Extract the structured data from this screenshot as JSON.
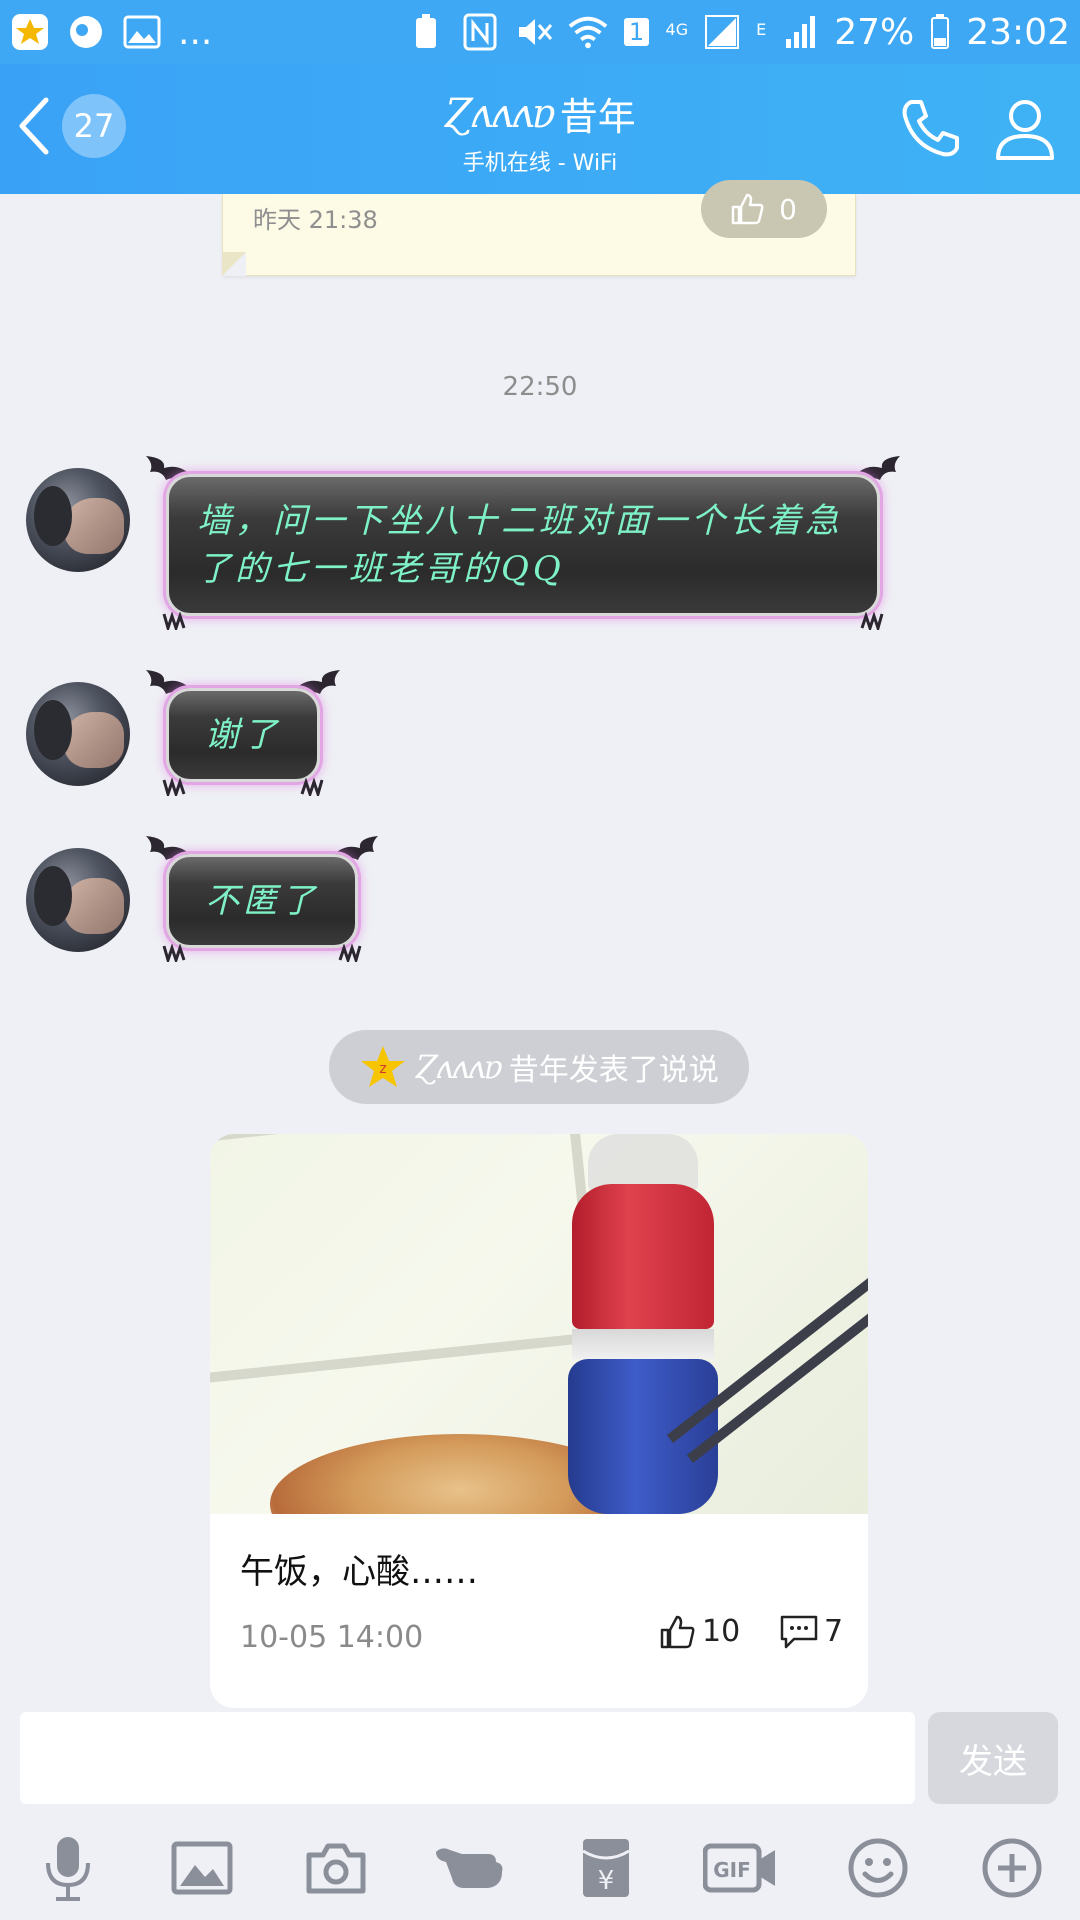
{
  "status_bar": {
    "overflow_dots": "...",
    "sim_badge": "1",
    "network_4g": "4G",
    "network_e": "E",
    "battery": "27%",
    "time": "23:02"
  },
  "header": {
    "unread_count": "27",
    "contact_sig": "Ɀʌʌʌɐ",
    "contact_name": "昔年",
    "status": "手机在线 - WiFi"
  },
  "prev_card": {
    "time": "昨天 21:38",
    "likes": "0"
  },
  "timestamp": "22:50",
  "messages": [
    {
      "text": "墙，问一下坐八十二班对面一个长着急了的七一班老哥的QQ"
    },
    {
      "text": "谢了"
    },
    {
      "text": "不匿了"
    }
  ],
  "notice": {
    "sig": "Ɀʌʌʌɐ",
    "text": "昔年发表了说说"
  },
  "post": {
    "text": "午饭，心酸……",
    "time": "10-05 14:00",
    "likes": "10",
    "comments": "7"
  },
  "input": {
    "placeholder": "",
    "send_label": "发送"
  },
  "toolbar": {
    "icons": [
      "microphone-icon",
      "image-icon",
      "camera-icon",
      "poke-hand-icon",
      "red-packet-icon",
      "gif-icon",
      "emoji-icon",
      "plus-icon"
    ]
  },
  "colors": {
    "header": "#3aa2f6",
    "bubble_text": "#7ef2c6",
    "bubble_glow": "#e2a6e4",
    "background": "#eff0f5"
  }
}
